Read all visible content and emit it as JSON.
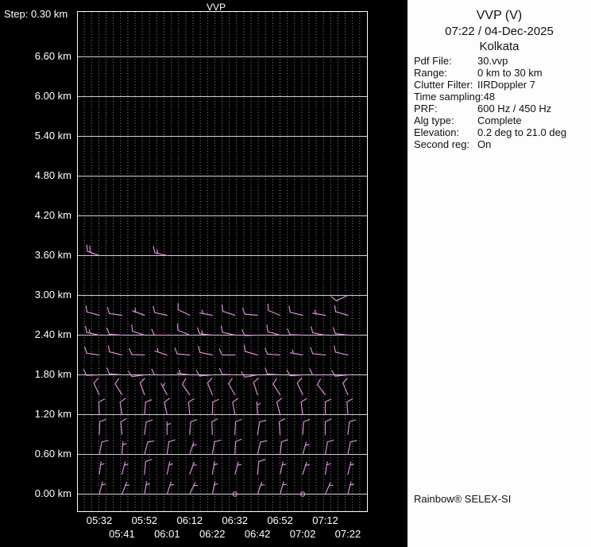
{
  "plot": {
    "title": "VVP",
    "step_label": "Step: 0.30 km",
    "y_axis": {
      "labels": [
        "6.60 km",
        "6.00 km",
        "5.40 km",
        "4.80 km",
        "4.20 km",
        "3.60 km",
        "3.00 km",
        "2.40 km",
        "1.80 km",
        "1.20 km",
        "0.60 km",
        "0.00 km"
      ],
      "unit": "km",
      "step_km": 0.3
    },
    "x_axis": {
      "labels_row1": [
        "05:32",
        "05:52",
        "06:12",
        "06:32",
        "06:52",
        "07:12"
      ],
      "labels_row2": [
        "05:41",
        "06:01",
        "06:22",
        "06:42",
        "07:02",
        "07:22"
      ]
    },
    "colors": {
      "background": "#000000",
      "text": "#ffffff",
      "frame": "#ffffff",
      "grid_minor": "#8f8f8f",
      "grid_major": "#cfcfcf",
      "barb": "#dd8add",
      "panel_background": "#fdfdfd",
      "panel_text": "#111111"
    }
  },
  "info_panel": {
    "title": "VVP (V)",
    "datetime": "07:22 / 04-Dec-2025",
    "site": "Kolkata",
    "fields": [
      {
        "label": "Pdf File:",
        "value": "30.vvp"
      },
      {
        "label": "Range:",
        "value": "0 km to 30 km"
      },
      {
        "label": "Clutter Filter:",
        "value": "IIRDoppler 7"
      },
      {
        "label": "Time sampling:",
        "value": "48"
      },
      {
        "label": "PRF:",
        "value": "600 Hz / 450 Hz"
      },
      {
        "label": "Alg type:",
        "value": "Complete"
      },
      {
        "label": "Elevation:",
        "value": "0.2 deg to 21.0 deg"
      },
      {
        "label": "Second reg:",
        "value": "On"
      }
    ],
    "footer": "Rainbow® SELEX-SI"
  },
  "chart_data": {
    "type": "scatter",
    "subtype": "wind_barb_time_height_profile",
    "title": "VVP",
    "xlabel": "",
    "ylabel": "",
    "x_categories": [
      "05:32",
      "05:41",
      "05:52",
      "06:01",
      "06:12",
      "06:22",
      "06:32",
      "06:42",
      "06:52",
      "07:02",
      "07:12",
      "07:22"
    ],
    "height_step_km": 0.3,
    "ylim_km": [
      0,
      7.2
    ],
    "y_tick_labels_km": [
      6.6,
      6.0,
      5.4,
      4.8,
      4.2,
      3.6,
      3.0,
      2.4,
      1.8,
      1.2,
      0.6,
      0.0
    ],
    "grid": true,
    "legend": false,
    "barb_format": "[time_index, height_km, wind_from_direction_deg, speed_kt]; speed 0 = calm circle; values estimated from barb glyphs",
    "barbs": [
      [
        0,
        3.6,
        290,
        20
      ],
      [
        3,
        3.6,
        283,
        15
      ],
      [
        11,
        3,
        245,
        10
      ],
      [
        0,
        2.7,
        285,
        10
      ],
      [
        1,
        2.7,
        278,
        10
      ],
      [
        2,
        2.7,
        290,
        5
      ],
      [
        3,
        2.7,
        282,
        10
      ],
      [
        4,
        2.7,
        295,
        10
      ],
      [
        5,
        2.7,
        280,
        5
      ],
      [
        6,
        2.7,
        288,
        10
      ],
      [
        7,
        2.7,
        275,
        10
      ],
      [
        8,
        2.7,
        292,
        10
      ],
      [
        9,
        2.7,
        283,
        10
      ],
      [
        10,
        2.7,
        279,
        5
      ],
      [
        11,
        2.7,
        286,
        10
      ],
      [
        0,
        2.4,
        282,
        15
      ],
      [
        1,
        2.4,
        274,
        10
      ],
      [
        2,
        2.4,
        288,
        10
      ],
      [
        3,
        2.4,
        270,
        10
      ],
      [
        4,
        2.4,
        292,
        10
      ],
      [
        5,
        2.4,
        276,
        15
      ],
      [
        6,
        2.4,
        283,
        10
      ],
      [
        7,
        2.4,
        268,
        10
      ],
      [
        8,
        2.4,
        286,
        10
      ],
      [
        9,
        2.4,
        272,
        10
      ],
      [
        10,
        2.4,
        280,
        10
      ],
      [
        11,
        2.4,
        277,
        10
      ],
      [
        0,
        2.1,
        278,
        10
      ],
      [
        1,
        2.1,
        284,
        10
      ],
      [
        2,
        2.1,
        272,
        10
      ],
      [
        3,
        2.1,
        288,
        5
      ],
      [
        4,
        2.1,
        275,
        10
      ],
      [
        5,
        2.1,
        282,
        10
      ],
      [
        6,
        2.1,
        270,
        10
      ],
      [
        7,
        2.1,
        286,
        10
      ],
      [
        8,
        2.1,
        274,
        10
      ],
      [
        9,
        2.1,
        280,
        5
      ],
      [
        10,
        2.1,
        276,
        10
      ],
      [
        11,
        2.1,
        283,
        10
      ],
      [
        0,
        1.8,
        268,
        10
      ],
      [
        1,
        1.8,
        275,
        10
      ],
      [
        2,
        1.8,
        262,
        10
      ],
      [
        3,
        1.8,
        270,
        10
      ],
      [
        4,
        1.8,
        278,
        5
      ],
      [
        5,
        1.8,
        265,
        10
      ],
      [
        6,
        1.8,
        272,
        10
      ],
      [
        7,
        1.8,
        260,
        10
      ],
      [
        8,
        1.8,
        274,
        10
      ],
      [
        9,
        1.8,
        266,
        10
      ],
      [
        10,
        1.8,
        270,
        10
      ],
      [
        11,
        1.8,
        264,
        10
      ],
      [
        0,
        1.5,
        335,
        10
      ],
      [
        1,
        1.5,
        328,
        10
      ],
      [
        2,
        1.5,
        340,
        10
      ],
      [
        3,
        1.5,
        332,
        5
      ],
      [
        4,
        1.5,
        325,
        10
      ],
      [
        5,
        1.5,
        338,
        10
      ],
      [
        6,
        1.5,
        330,
        10
      ],
      [
        7,
        1.5,
        342,
        10
      ],
      [
        8,
        1.5,
        327,
        10
      ],
      [
        9,
        1.5,
        335,
        10
      ],
      [
        10,
        1.5,
        322,
        10
      ],
      [
        11,
        1.5,
        337,
        10
      ],
      [
        0,
        1.2,
        358,
        10
      ],
      [
        1,
        1.2,
        352,
        10
      ],
      [
        2,
        1.2,
        5,
        10
      ],
      [
        3,
        1.2,
        348,
        10
      ],
      [
        4,
        1.2,
        355,
        10
      ],
      [
        5,
        1.2,
        2,
        10
      ],
      [
        6,
        1.2,
        350,
        10
      ],
      [
        7,
        1.2,
        357,
        5
      ],
      [
        8,
        1.2,
        345,
        10
      ],
      [
        9,
        1.2,
        353,
        10
      ],
      [
        10,
        1.2,
        0,
        10
      ],
      [
        11,
        1.2,
        356,
        10
      ],
      [
        0,
        0.9,
        2,
        10
      ],
      [
        1,
        0.9,
        355,
        10
      ],
      [
        2,
        0.9,
        8,
        10
      ],
      [
        3,
        0.9,
        0,
        5
      ],
      [
        4,
        0.9,
        5,
        10
      ],
      [
        5,
        0.9,
        358,
        10
      ],
      [
        6,
        0.9,
        3,
        10
      ],
      [
        7,
        0.9,
        10,
        10
      ],
      [
        8,
        0.9,
        356,
        10
      ],
      [
        9,
        0.9,
        4,
        10
      ],
      [
        10,
        0.9,
        0,
        10
      ],
      [
        11,
        0.9,
        7,
        10
      ],
      [
        0,
        0.6,
        12,
        10
      ],
      [
        1,
        0.6,
        5,
        5
      ],
      [
        2,
        0.6,
        15,
        10
      ],
      [
        3,
        0.6,
        8,
        10
      ],
      [
        4,
        0.6,
        18,
        5
      ],
      [
        5,
        0.6,
        10,
        10
      ],
      [
        6,
        0.6,
        3,
        10
      ],
      [
        7,
        0.6,
        14,
        10
      ],
      [
        8,
        0.6,
        7,
        10
      ],
      [
        9,
        0.6,
        16,
        5
      ],
      [
        10,
        0.6,
        10,
        10
      ],
      [
        11,
        0.6,
        12,
        10
      ],
      [
        0,
        0.3,
        8,
        5
      ],
      [
        1,
        0.3,
        15,
        5
      ],
      [
        2,
        0.3,
        5,
        10
      ],
      [
        3,
        0.3,
        12,
        5
      ],
      [
        4,
        0.3,
        20,
        5
      ],
      [
        5,
        0.3,
        10,
        5
      ],
      [
        6,
        0.3,
        16,
        5
      ],
      [
        7,
        0.3,
        6,
        10
      ],
      [
        8,
        0.3,
        13,
        5
      ],
      [
        9,
        0.3,
        18,
        5
      ],
      [
        10,
        0.3,
        9,
        5
      ],
      [
        11,
        0.3,
        14,
        5
      ],
      [
        0,
        0,
        15,
        5
      ],
      [
        1,
        0,
        22,
        5
      ],
      [
        2,
        0,
        10,
        5
      ],
      [
        3,
        0,
        18,
        5
      ],
      [
        4,
        0,
        25,
        5
      ],
      [
        5,
        0,
        12,
        5
      ],
      [
        6,
        0,
        0,
        0
      ],
      [
        7,
        0,
        20,
        5
      ],
      [
        8,
        0,
        16,
        5
      ],
      [
        9,
        0,
        0,
        0
      ],
      [
        10,
        0,
        24,
        5
      ],
      [
        11,
        0,
        14,
        5
      ]
    ]
  }
}
